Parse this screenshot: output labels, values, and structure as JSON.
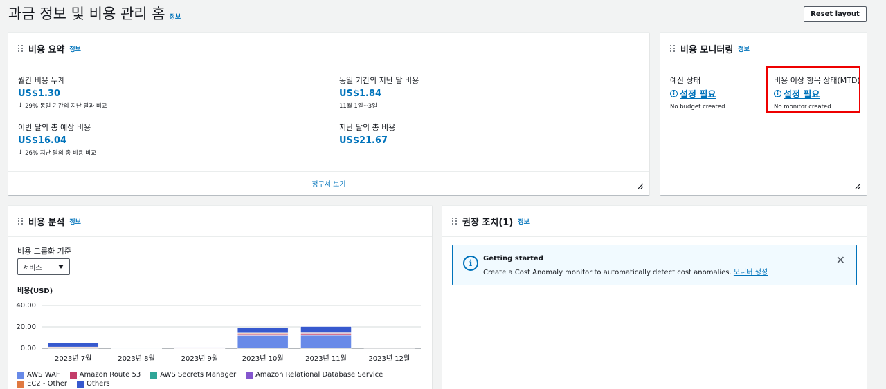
{
  "header": {
    "title": "과금 정보 및 비용 관리 홈",
    "info": "정보",
    "reset_label": "Reset layout"
  },
  "cost_summary": {
    "title": "비용 요약",
    "info": "정보",
    "mtd": {
      "label": "월간 비용 누계",
      "value": "US$1.30",
      "note": "29% 동일 기간의 지난 달과 비교"
    },
    "prev_same": {
      "label": "동일 기간의 지난 달 비용",
      "value": "US$1.84",
      "note": "11월 1일~3일"
    },
    "forecast": {
      "label": "이번 달의 총 예상 비용",
      "value": "US$16.04",
      "note": "26% 지난 달의 총 비용 비교"
    },
    "last_month": {
      "label": "지난 달의 총 비용",
      "value": "US$21.67"
    },
    "footer": "청구서 보기"
  },
  "cost_monitoring": {
    "title": "비용 모니터링",
    "info": "정보",
    "budget": {
      "label": "예산 상태",
      "value": "설정 필요",
      "note": "No budget created"
    },
    "anomaly": {
      "label": "비용 이상 항목 상태(MTD)",
      "value": "설정 필요",
      "note": "No monitor created"
    }
  },
  "cost_analysis": {
    "title": "비용 분석",
    "info": "정보",
    "group_label": "비용 그룹화 기준",
    "group_value": "서비스",
    "y_title": "비용(USD)"
  },
  "recommended": {
    "title": "권장 조치(1)",
    "info": "정보",
    "alert_title": "Getting started",
    "alert_text": "Create a Cost Anomaly monitor to automatically detect cost anomalies.",
    "alert_link": "모니터 생성"
  },
  "chart_data": {
    "type": "bar",
    "stacked": true,
    "categories": [
      "2023년 7월",
      "2023년 8월",
      "2023년 9월",
      "2023년 10월",
      "2023년 11월",
      "2023년 12월"
    ],
    "y_ticks": [
      "40.00",
      "20.00",
      "0.00"
    ],
    "ylim": [
      0,
      40
    ],
    "ylabel": "비용(USD)",
    "series": [
      {
        "name": "AWS WAF",
        "color": "#688ae8",
        "values": [
          0.8,
          0.2,
          0.2,
          12.0,
          12.2,
          0
        ]
      },
      {
        "name": "Amazon Route 53",
        "color": "#c33d69",
        "values": [
          0.2,
          0.1,
          0.1,
          1.0,
          1.0,
          0.8
        ]
      },
      {
        "name": "AWS Secrets Manager",
        "color": "#2ea597",
        "values": [
          0,
          0.1,
          0.2,
          0.3,
          0.3,
          0
        ]
      },
      {
        "name": "Amazon Relational Database Service",
        "color": "#8456ce",
        "values": [
          0.1,
          0,
          0,
          0.4,
          0.4,
          0
        ]
      },
      {
        "name": "EC2 - Other",
        "color": "#e07941",
        "values": [
          0.1,
          0,
          0,
          0.6,
          0.6,
          0
        ]
      },
      {
        "name": "Others",
        "color": "#3759ce",
        "values": [
          3.6,
          0.1,
          0.2,
          4.7,
          5.8,
          0
        ]
      }
    ]
  }
}
